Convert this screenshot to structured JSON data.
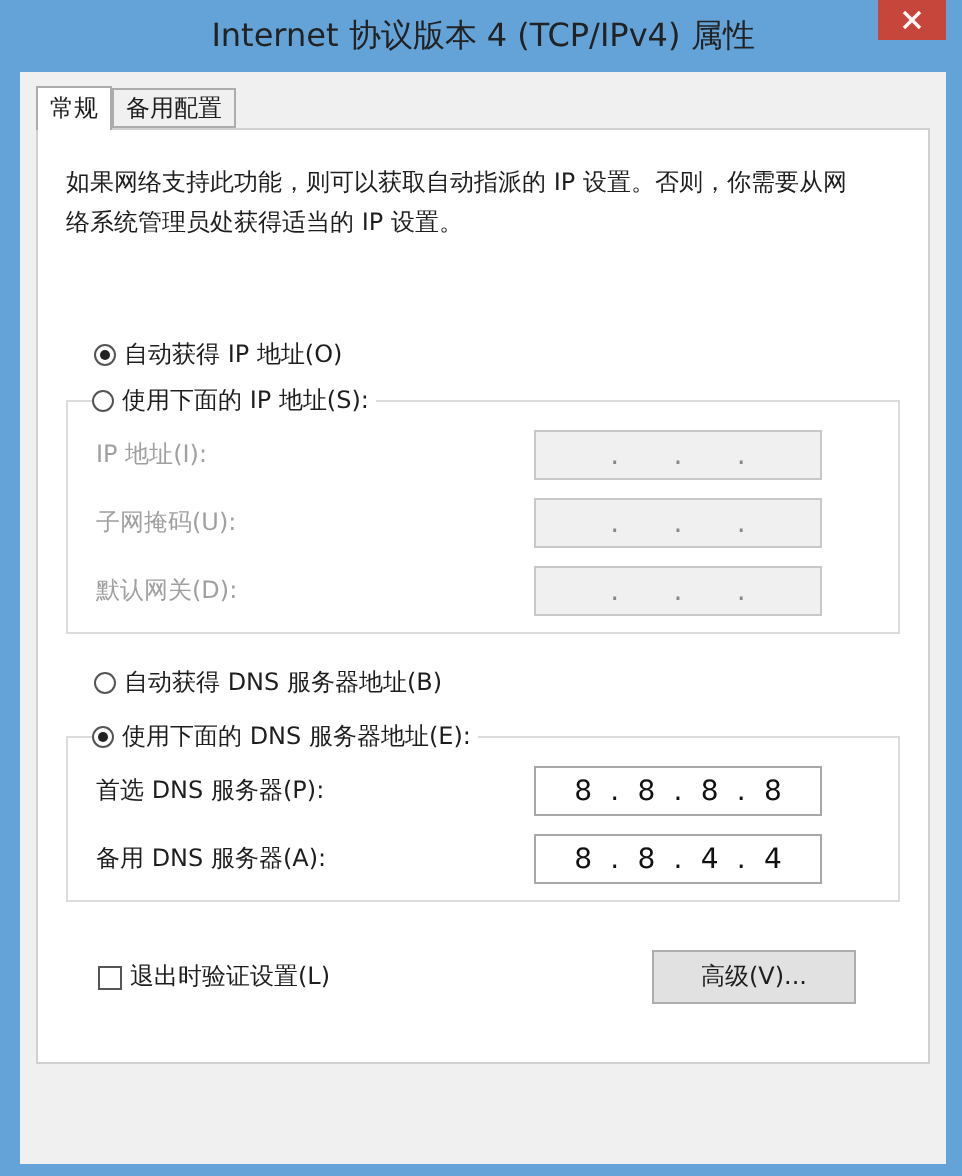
{
  "window": {
    "title": "Internet 协议版本 4 (TCP/IPv4) 属性"
  },
  "tabs": [
    {
      "label": "常规",
      "selected": true
    },
    {
      "label": "备用配置",
      "selected": false
    }
  ],
  "description": "如果网络支持此功能，则可以获取自动指派的 IP 设置。否则，你需要从网络系统管理员处获得适当的 IP 设置。",
  "ip_mode": [
    {
      "label": "自动获得 IP 地址(O)",
      "selected": true
    },
    {
      "label": "使用下面的 IP 地址(S):",
      "selected": false
    }
  ],
  "ip_fields": [
    {
      "label": "IP 地址(I):",
      "disabled": true,
      "separator": "."
    },
    {
      "label": "子网掩码(U):",
      "disabled": true,
      "separator": "."
    },
    {
      "label": "默认网关(D):",
      "disabled": true,
      "separator": "."
    }
  ],
  "dns_mode": [
    {
      "label": "自动获得 DNS 服务器地址(B)",
      "selected": false
    },
    {
      "label": "使用下面的 DNS 服务器地址(E):",
      "selected": true
    }
  ],
  "dns_fields": [
    {
      "label": "首选 DNS 服务器(P):",
      "disabled": false,
      "separator": ".",
      "segments": [
        "8",
        "8",
        "8",
        "8"
      ]
    },
    {
      "label": "备用 DNS 服务器(A):",
      "disabled": false,
      "separator": ".",
      "segments": [
        "8",
        "8",
        "4",
        "4"
      ]
    }
  ],
  "validate": {
    "label": "退出时验证设置(L)",
    "checked": false
  },
  "advanced_button": {
    "label": "高级(V)..."
  }
}
